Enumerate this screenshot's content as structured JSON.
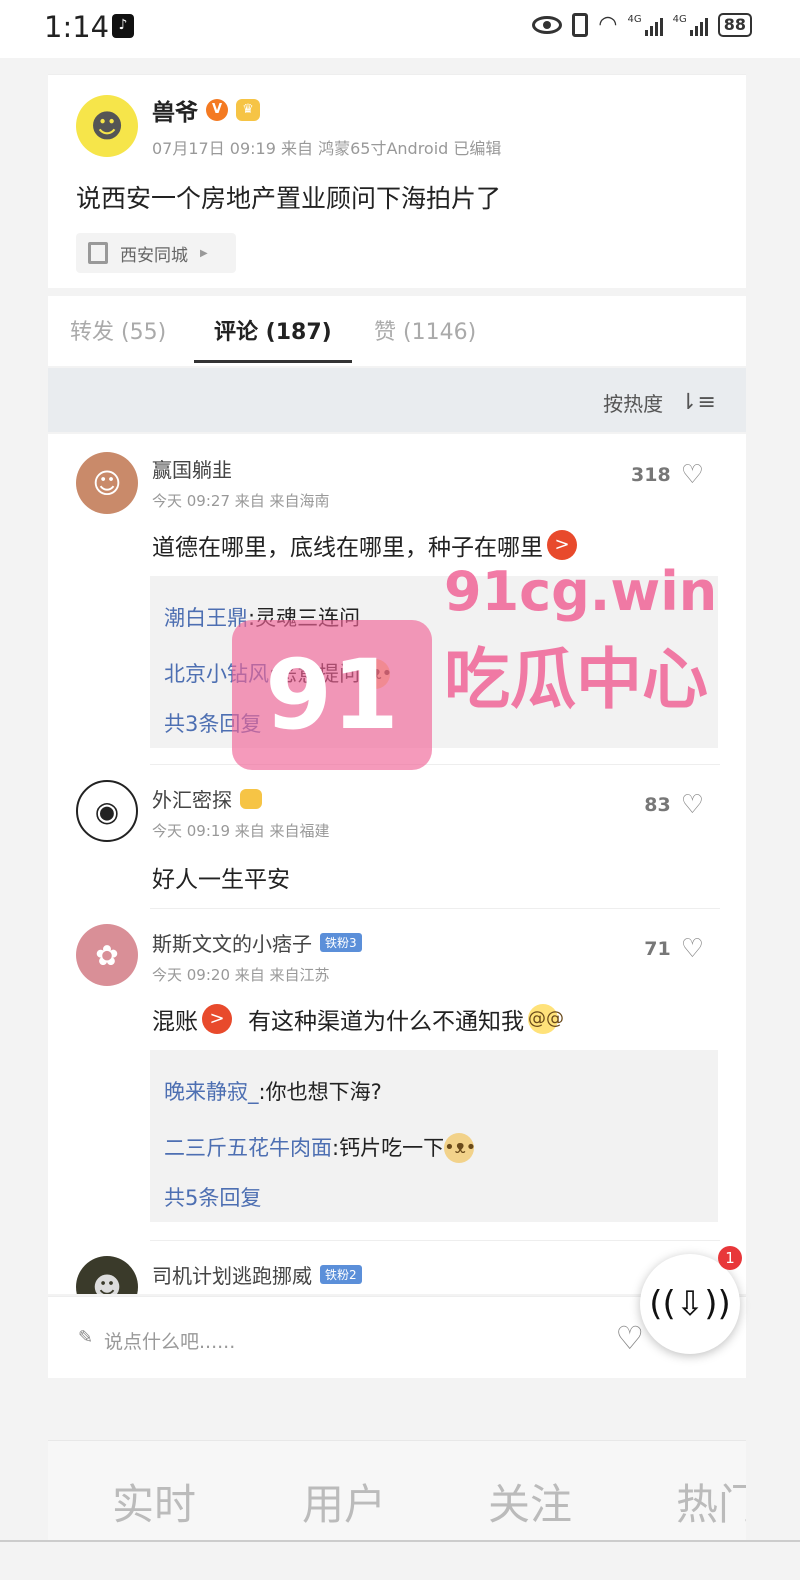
{
  "status_bar": {
    "time": "1:14",
    "signal_1": "4G",
    "signal_2": "4G",
    "battery": "88"
  },
  "post": {
    "author": "兽爷",
    "meta": "07月17日 09:19  来自 鸿蒙65寸Android  已编辑",
    "text": "说西安一个房地产置业顾问下海拍片了",
    "location": "西安同城"
  },
  "tabs": [
    {
      "label": "转发 (55)"
    },
    {
      "label": "评论 (187)"
    },
    {
      "label": "赞 (1146)"
    }
  ],
  "sort": {
    "label": "按热度",
    "icon": "sort-icon"
  },
  "comments": [
    {
      "name": "赢国躺韭",
      "meta": "今天 09:27 来自 来自海南",
      "likes": "318",
      "text": "道德在哪里，底线在哪里，种子在哪里",
      "replies": [
        {
          "name": "潮白王鼎",
          "text": ":灵魂三连问"
        },
        {
          "name": "北京小钻风",
          "text": ":恶意提问"
        }
      ],
      "reply_count": "共3条回复"
    },
    {
      "name": "外汇密探",
      "meta": "今天 09:19 来自 来自福建",
      "likes": "83",
      "text": "好人一生平安"
    },
    {
      "name": "斯斯文文的小痞子",
      "badge": "铁粉3",
      "meta": "今天 09:20 来自 来自江苏",
      "likes": "71",
      "text_a": "混账",
      "text_b": "有这种渠道为什么不通知我",
      "replies": [
        {
          "name": "晚来静寂_",
          "text": ":你也想下海?"
        },
        {
          "name": "二三斤五花牛肉面",
          "text": ":钙片吃一下"
        }
      ],
      "reply_count": "共5条回复"
    },
    {
      "name": "司机计划逃跑挪威",
      "badge": "铁粉2"
    }
  ],
  "watermark": {
    "box_text": "91",
    "url": "91cg.win",
    "label": "吃瓜中心"
  },
  "input": {
    "placeholder": "说点什么吧......"
  },
  "fab": {
    "badge": "1"
  },
  "bottom_nav": [
    {
      "label": "实时"
    },
    {
      "label": "用户"
    },
    {
      "label": "关注"
    },
    {
      "label": "热门"
    }
  ]
}
